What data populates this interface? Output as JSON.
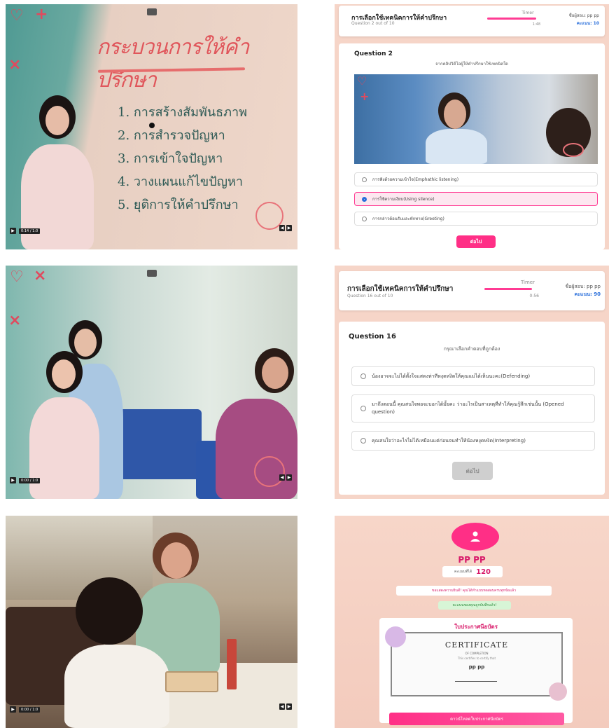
{
  "video1": {
    "title": "กระบวนการให้คำปรึกษา",
    "steps": [
      "1. การสร้างสัมพันธภาพ",
      "2. การสำรวจปัญหา",
      "3. การเข้าใจปัญหา",
      "4. วางแผนแก้ไขปัญหา",
      "5. ยุติการให้คำปรึกษา"
    ],
    "time": "0:14 / 1:0"
  },
  "video2": {
    "time": "0:00 / 1:0"
  },
  "video3": {
    "time": "0:00 / 1:0"
  },
  "quiz1": {
    "title": "การเลือกใช้เทคนิคการให้คำปรึกษา",
    "progress": "Question 2 out of 10",
    "timer_label": "Timer",
    "timer_value": "1:48",
    "user": "ชื่อผู้สอบ: pp pp",
    "score": "คะแนน: 10",
    "question_label": "Question 2",
    "prompt": "จากคลิปวิดีโอผู้ให้คำปรึกษาใช้เทคนิคใด",
    "options": [
      "การฟังด้วยความเข้าใจ(Emphathic listening)",
      "การใช้ความเงียบ(Using silence)",
      "การกล่าวต้อนรับและทักทาย(Greeting)"
    ],
    "selected_index": 1,
    "next_label": "ต่อไป"
  },
  "quiz2": {
    "title": "การเลือกใช้เทคนิคการให้คำปรึกษา",
    "progress": "Question 16 out of 10",
    "timer_label": "Timer",
    "timer_value": "0:56",
    "user": "ชื่อผู้สอบ: pp pp",
    "score": "คะแนน: 90",
    "question_label": "Question 16",
    "prompt": "กรุณาเลือกคำตอบที่ถูกต้อง",
    "options": [
      "น้องอาจจะไม่ได้ตั้งใจแสดงท่าทีหงุดหงิดให้คุณแม่ได้เห็นนะคะ(Defending)",
      "มาถึงตอนนี้ คุณสนใจพอจะบอกได้มั้ยคะ ว่าอะไรเป็นสาเหตุที่ทำให้คุณรู้สึกเช่นนั้น (Opened question)",
      "คุณสนใจว่าอะไรไม่ได้เหมือนแต่ก่อนจนทำให้น้องหงุดหงิด(Interpreting)"
    ],
    "next_label": "ต่อไป"
  },
  "result": {
    "name": "PP PP",
    "score_label": "คะแนนที่ได้",
    "score_value": "120",
    "congrats": "ขอแสดงความยินดี! คุณได้ทำแบบทดสอบครบทุกข้อแล้ว",
    "saved": "คะแนนของคุณถูกบันทึกแล้ว!",
    "cert_heading": "ใบประกาศนียบัตร",
    "cert_title": "CERTIFICATE",
    "cert_subtitle": "OF COMPLETION",
    "cert_certify": "This certifies to certify that",
    "cert_name": "pp pp",
    "download_label": "ดาวน์โหลดใบประกาศนียบัตร"
  },
  "colors": {
    "accent": "#ff3b93",
    "blue": "#2a6fdb",
    "teal": "#4f9a93",
    "slide_red": "#e0565b"
  }
}
